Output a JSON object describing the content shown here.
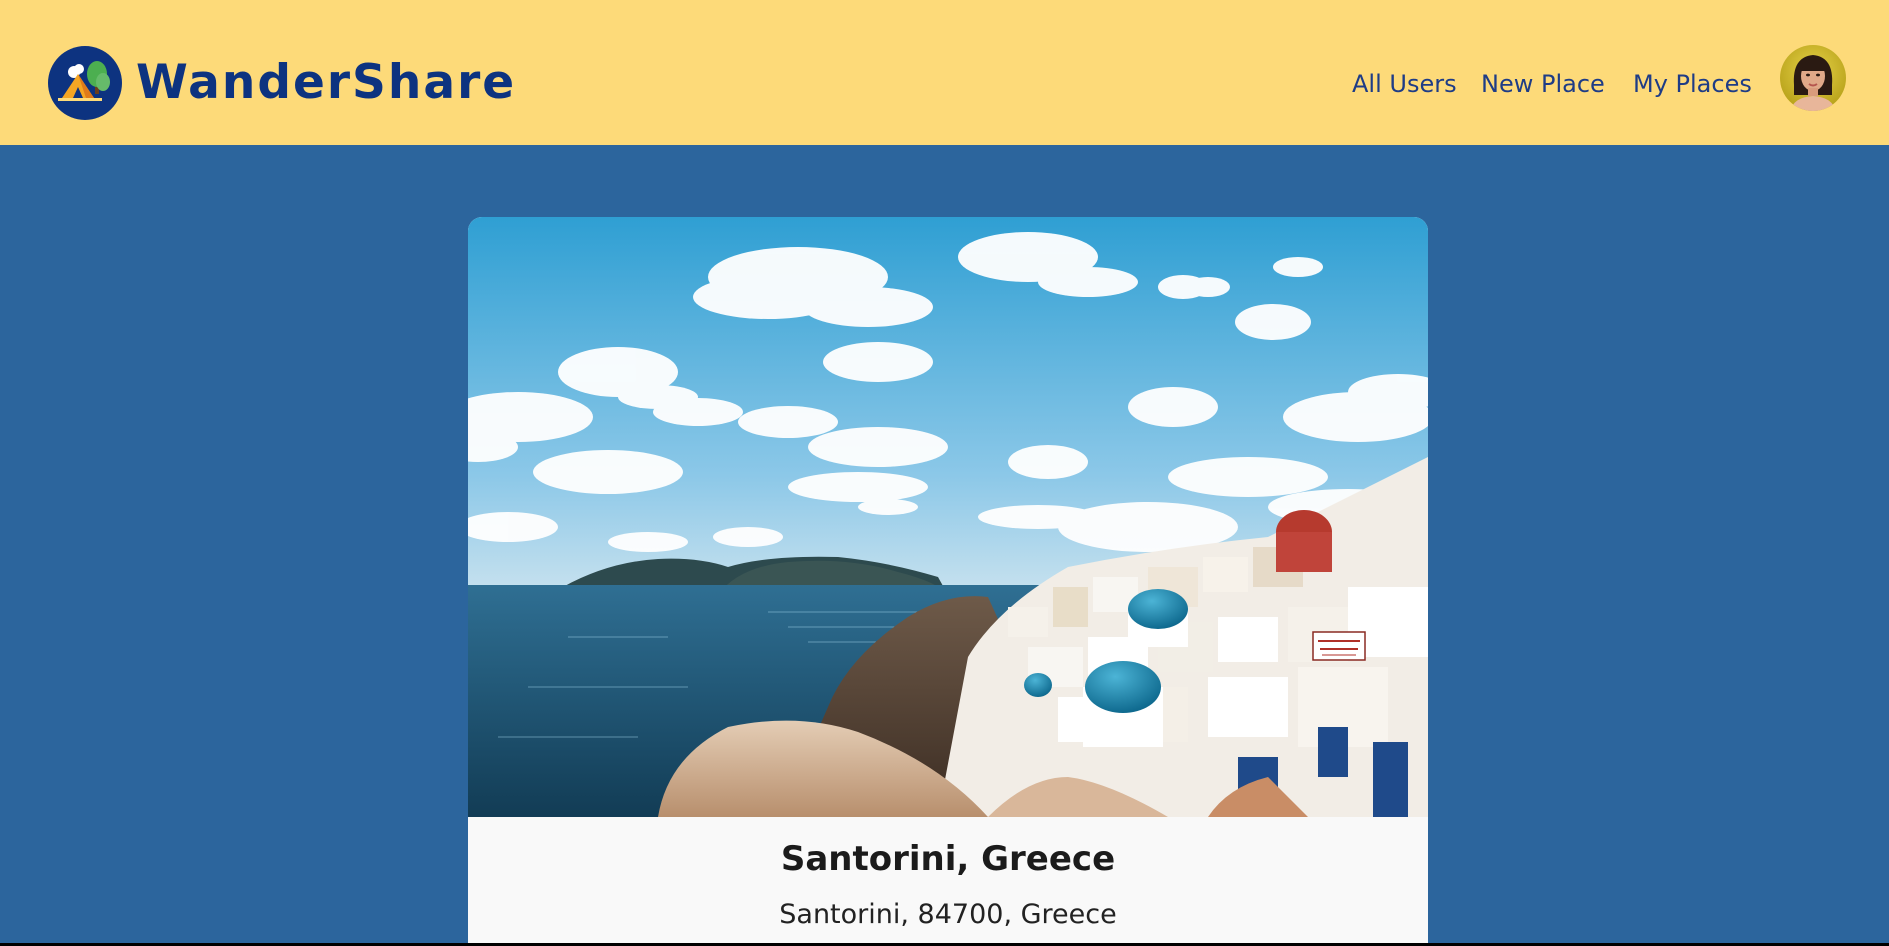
{
  "header": {
    "brand": "WanderShare",
    "nav": [
      {
        "label": "All Users"
      },
      {
        "label": "New Place"
      },
      {
        "label": "My Places"
      }
    ],
    "avatar_icon": "user-avatar-icon",
    "logo_icon": "tent-forest-logo-icon"
  },
  "place": {
    "title": "Santorini, Greece",
    "address": "Santorini, 84700, Greece",
    "image_sign_text": "ΠΩΛΕΙΤΑΙ FOR SALE"
  },
  "colors": {
    "header_bg": "#fdda79",
    "page_bg": "#2c659d",
    "brand_text": "#0d3380",
    "nav_text": "#1e3c86",
    "card_bg": "#f9f9f9"
  }
}
